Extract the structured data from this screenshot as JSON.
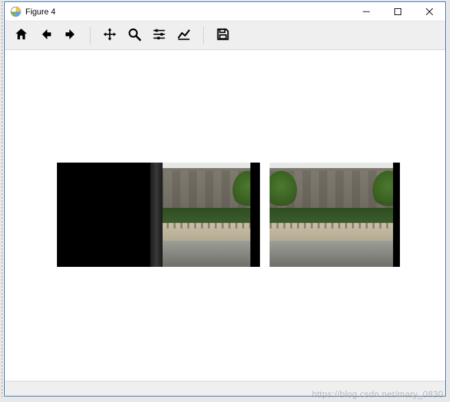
{
  "window": {
    "title": "Figure 4",
    "icon_name": "matplotlib-icon"
  },
  "toolbar": {
    "home_label": "Home",
    "back_label": "Back",
    "forward_label": "Forward",
    "pan_label": "Pan",
    "zoom_label": "Zoom",
    "subplots_label": "Configure subplots",
    "axes_label": "Edit axis",
    "save_label": "Save"
  },
  "watermark": "https://blog.csdn.net/mary_0830"
}
